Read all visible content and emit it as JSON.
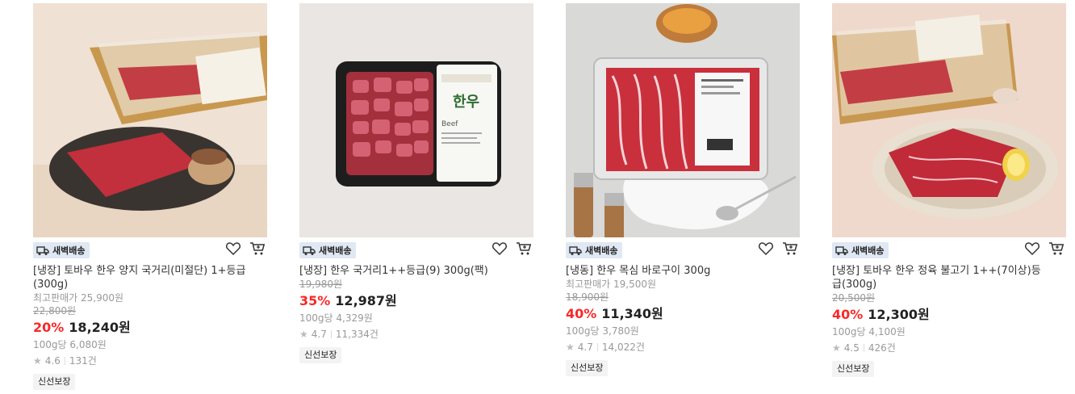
{
  "delivery_badge": "새벽배송",
  "fresh_tag": "신선보장",
  "products": [
    {
      "title": "[냉장] 토바우 한우 양지 국거리(미절단) 1+등급 (300g)",
      "lowest_label": "최고판매가 25,900원",
      "original_price": "22,800원",
      "discount": "20%",
      "price": "18,240원",
      "unit_price": "100g당 6,080원",
      "rating": "4.6",
      "reviews": "131건"
    },
    {
      "title": "[냉장] 한우 국거리1++등급(9) 300g(팩)",
      "lowest_label": "",
      "original_price": "19,980원",
      "discount": "35%",
      "price": "12,987원",
      "unit_price": "100g당 4,329원",
      "rating": "4.7",
      "reviews": "11,334건"
    },
    {
      "title": "[냉동] 한우 목심 바로구이 300g",
      "lowest_label": "최고판매가 19,500원",
      "original_price": "18,900원",
      "discount": "40%",
      "price": "11,340원",
      "unit_price": "100g당 3,780원",
      "rating": "4.7",
      "reviews": "14,022건"
    },
    {
      "title": "[냉장] 토바우 한우 정육 불고기 1++(7이상)등급(300g)",
      "lowest_label": "",
      "original_price": "20,500원",
      "discount": "40%",
      "price": "12,300원",
      "unit_price": "100g당 4,100원",
      "rating": "4.5",
      "reviews": "426건"
    }
  ],
  "icons": [
    "truck-icon",
    "heart-icon",
    "cart-icon",
    "star-icon"
  ],
  "colors": {
    "discount": "#fa2828",
    "badge_bg": "#dfe8f3"
  }
}
